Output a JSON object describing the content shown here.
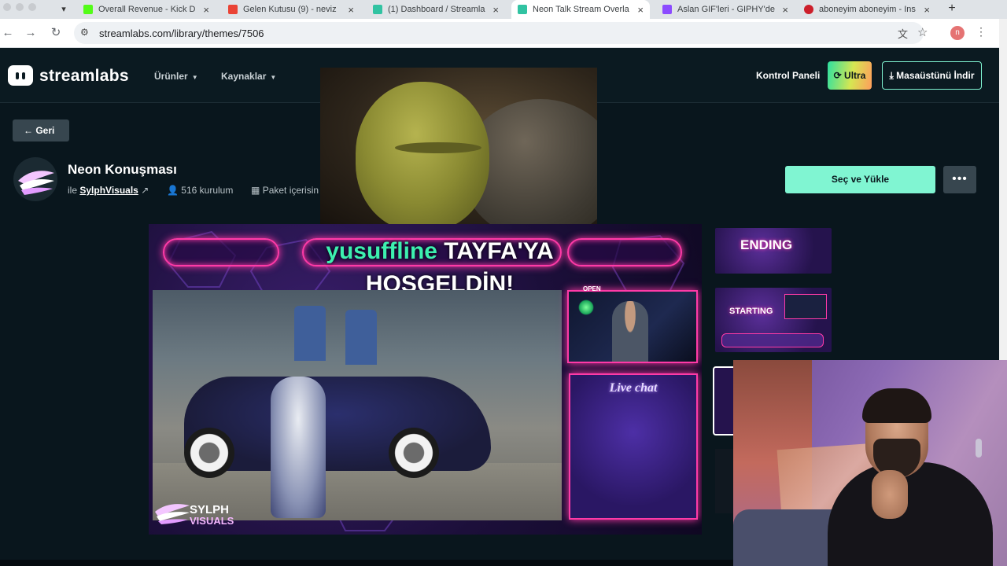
{
  "browser": {
    "tabs": [
      {
        "label": "Overall Revenue - Kick D",
        "fav": "#53fc18"
      },
      {
        "label": "Gelen Kutusu (9) - neviz",
        "fav": "#ea4335"
      },
      {
        "label": "(1) Dashboard / Streamla",
        "fav": "#31c3a2"
      },
      {
        "label": "Neon Talk Stream Overla",
        "fav": "#31c3a2"
      },
      {
        "label": "Aslan GIF'leri - GIPHY'de",
        "fav": "#8c4bff"
      },
      {
        "label": "aboneyim aboneyim - Ins",
        "fav": "#cc1f2b"
      }
    ],
    "url": "streamlabs.com/library/themes/7506",
    "profile_initial": "n"
  },
  "header": {
    "brand": "streamlabs",
    "nav": [
      {
        "label": "Ürünler"
      },
      {
        "label": "Kaynaklar"
      }
    ],
    "dashboard_label": "Kontrol Paneli",
    "ultra_label": "Ultra",
    "download_label": "Masaüstünü İndir"
  },
  "theme": {
    "back_label": "Geri",
    "title": "Neon Konuşması",
    "author_prefix": "ile",
    "author": "SylphVisuals",
    "installs": "516 kurulum",
    "bundle": "Paket içerisin",
    "select_label": "Seç ve Yükle",
    "more_label": "•••"
  },
  "preview": {
    "welcome_user": "yusuffline",
    "welcome_rest": " TAYFA'YA",
    "welcome_line2": "HOŞGELDİN!",
    "open_tag": "OPEN",
    "chat_label": "Live chat",
    "brand_line1": "SYLPH",
    "brand_line2": "VISUALS"
  },
  "thumbnails": [
    {
      "label": "ENDING"
    },
    {
      "label": "STARTING"
    }
  ],
  "colors": {
    "accent": "#80f5d2",
    "neon_pink": "#ff3aa7",
    "username_green": "#3df0b0"
  }
}
